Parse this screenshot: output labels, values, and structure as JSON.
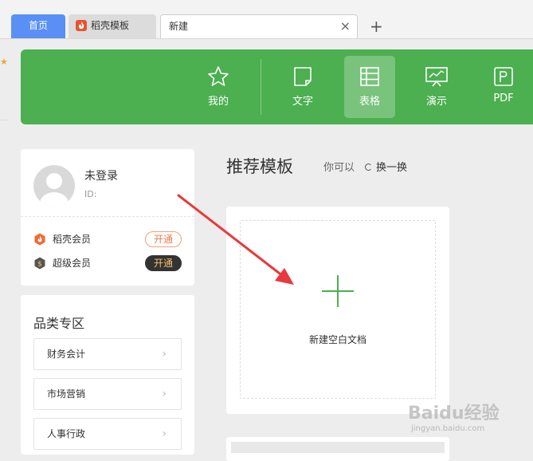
{
  "tabs": [
    {
      "label": "首页"
    },
    {
      "label": "稻壳模板"
    },
    {
      "label": "新建"
    }
  ],
  "nav": {
    "items": [
      {
        "label": "我的",
        "icon": "star-icon"
      },
      {
        "label": "文字",
        "icon": "document-icon"
      },
      {
        "label": "表格",
        "icon": "spreadsheet-icon",
        "active": true
      },
      {
        "label": "演示",
        "icon": "presentation-icon"
      },
      {
        "label": "PDF",
        "icon": "pdf-icon"
      }
    ]
  },
  "user": {
    "name": "未登录",
    "id_label": "ID:"
  },
  "membership": {
    "daoke_label": "稻壳会员",
    "daoke_button": "开通",
    "super_label": "超级会员",
    "super_button": "开通"
  },
  "categories": {
    "title": "品类专区",
    "items": [
      {
        "label": "财务会计"
      },
      {
        "label": "市场营销"
      },
      {
        "label": "人事行政"
      }
    ]
  },
  "main": {
    "title": "推荐模板",
    "hint": "你可以",
    "refresh_label": "换一换",
    "new_blank_label": "新建空白文档"
  },
  "watermark": {
    "text": "Baidu经验",
    "sub": "jingyan.baidu.com"
  },
  "colors": {
    "accent": "#4caf50",
    "tab_active": "#5a8ff5",
    "arrow": "#e8393d"
  }
}
